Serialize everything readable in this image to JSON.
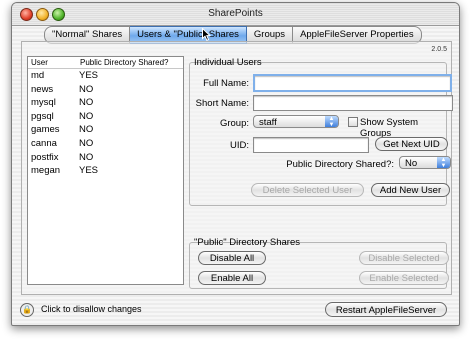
{
  "window": {
    "title": "SharePoints"
  },
  "tabs": [
    "\"Normal\" Shares",
    "Users & \"Public\" Shares",
    "Groups",
    "AppleFileServer Properties"
  ],
  "version": "2.0.5",
  "user_list": {
    "headers": [
      "User",
      "Public Directory Shared?"
    ],
    "rows": [
      [
        "md",
        "YES"
      ],
      [
        "news",
        "NO"
      ],
      [
        "mysql",
        "NO"
      ],
      [
        "pgsql",
        "NO"
      ],
      [
        "games",
        "NO"
      ],
      [
        "canna",
        "NO"
      ],
      [
        "postfix",
        "NO"
      ],
      [
        "megan",
        "YES"
      ]
    ]
  },
  "individual_users": {
    "title": "Individual Users",
    "full_name_label": "Full Name:",
    "full_name_value": "",
    "short_name_label": "Short Name:",
    "short_name_value": "",
    "group_label": "Group:",
    "group_value": "staff",
    "show_system_groups": "Show System Groups",
    "uid_label": "UID:",
    "uid_value": "",
    "get_next_uid": "Get Next UID",
    "public_dir_label": "Public Directory Shared?:",
    "public_dir_value": "No",
    "delete_user": "Delete Selected User",
    "add_user": "Add New User"
  },
  "public_shares": {
    "title": "\"Public\" Directory Shares",
    "disable_all": "Disable All",
    "enable_all": "Enable All",
    "disable_selected": "Disable Selected",
    "enable_selected": "Enable Selected"
  },
  "footer": {
    "lock_text": "Click to disallow changes",
    "restart": "Restart AppleFileServer"
  }
}
